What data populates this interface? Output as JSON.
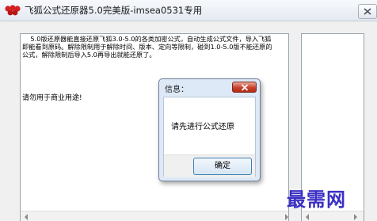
{
  "window": {
    "title": "飞狐公式还原器5.0完美版-imsea0531专用"
  },
  "main": {
    "description": "    5.0版还原器能直接还原飞狐3.0-5.0的各类加密公式，自动生成公式文件，导入飞狐即能看到原码。解除限制用于解除时间、版本、定向等限制，碰到1.0-5.0版不能还原的公式，解除限制后导入5.0再导出就能还原了。",
    "warning": "请勿用于商业用途!"
  },
  "dialog": {
    "title": "信息：",
    "message": "请先进行公式还原",
    "ok_label": "确定"
  },
  "watermark": {
    "text": "最需网"
  },
  "colors": {
    "dialog_bg": "#dde9f7",
    "close_red": "#c7442e",
    "watermark": "#3a2fc4"
  }
}
